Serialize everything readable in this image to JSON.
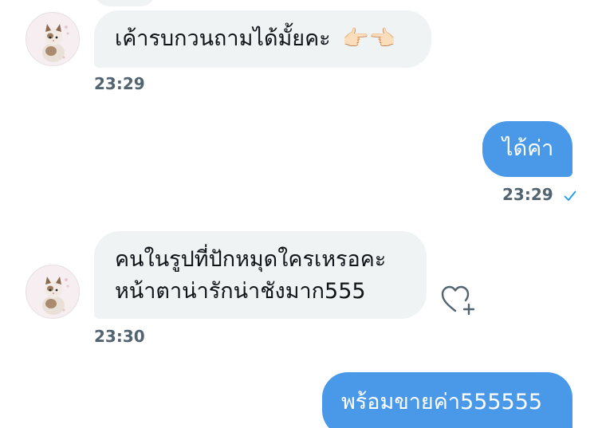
{
  "conversation": {
    "messages": [
      {
        "direction": "incoming",
        "text": "เค้ารบกวนถามได้มั้ยคะ",
        "emoji": "👉🏻👈🏻",
        "time": "23:29"
      },
      {
        "direction": "outgoing",
        "text": "ได้ค่า",
        "time": "23:29",
        "status": "seen"
      },
      {
        "direction": "incoming",
        "lines": [
          "คนในรูปที่ปักหมุดใครเหรอคะ",
          "หน้าตาน่ารักน่าชังมาก555"
        ],
        "time": "23:30"
      },
      {
        "direction": "outgoing",
        "text": "พร้อมขายค่า555555"
      }
    ]
  },
  "colors": {
    "incoming_bubble": "#eff3f4",
    "outgoing_bubble": "#4a99e9",
    "timestamp": "#536471",
    "seen_check": "#1d9bf0"
  },
  "icons": {
    "avatar": "cat-avatar-icon",
    "reaction": "heart-plus-icon",
    "read_receipt": "checkmark-icon"
  }
}
